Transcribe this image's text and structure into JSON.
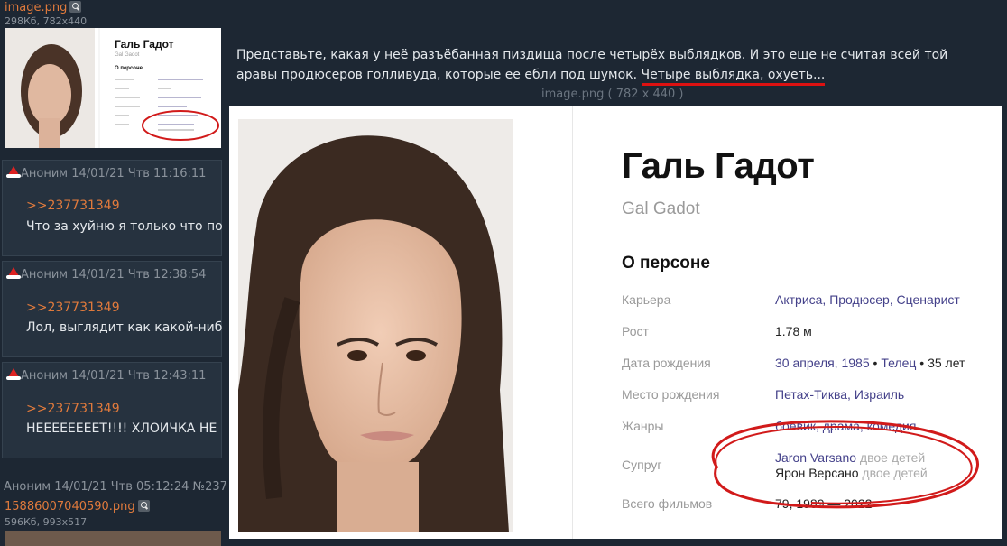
{
  "sidebar": {
    "file1": {
      "name": "image.png",
      "meta": "298Кб, 782x440"
    },
    "posts": [
      {
        "author": "Аноним",
        "date": "14/01/21 Чтв 11:16:11",
        "reply": ">>237731349",
        "text": "Что за хуйню я только что по"
      },
      {
        "author": "Аноним",
        "date": "14/01/21 Чтв 12:38:54",
        "reply": ">>237731349",
        "text": "Лол, выглядит как какой-ниб"
      },
      {
        "author": "Аноним",
        "date": "14/01/21 Чтв 12:43:11",
        "reply": ">>237731349",
        "text": "НЕЕЕЕЕЕЕЕТ!!!! ХЛОИЧКА НЕ"
      }
    ],
    "post4_head": "Аноним 14/01/21 Чтв 05:12:24 №237",
    "file2": {
      "name": "15886007040590.png",
      "meta": "596Кб, 993x517"
    }
  },
  "main": {
    "text_line1": "Представьте, какая у неё разъёбанная пиздища после четырёх выблядков. И это еще не считая всей той",
    "text_line2": "аравы продюсеров голливуда, которые ее ебли под шумок.",
    "text_underlined": "Четыре выблядка, охуеть...",
    "caption": "image.png ( 782 x 440 )"
  },
  "card": {
    "name": "Галь Гадот",
    "original_name": "Gal Gadot",
    "section_title": "О персоне",
    "rows": [
      {
        "label": "Карьера",
        "value": "Актриса, Продюсер, Сценарист"
      },
      {
        "label": "Рост",
        "value": "1.78 м"
      },
      {
        "label": "Дата рождения",
        "value_date": "30 апреля, 1985",
        "value_zodiac": "Телец",
        "value_age": "35 лет"
      },
      {
        "label": "Место рождения",
        "value": "Петах-Тиква, Израиль"
      },
      {
        "label": "Жанры",
        "value": "боевик, драма, комедия"
      },
      {
        "label": "Супруг",
        "spouse1": "Jaron Varsano",
        "spouse1_note": "двое детей",
        "spouse2": "Ярон Версано",
        "spouse2_note": "двое детей"
      },
      {
        "label": "Всего фильмов",
        "value": "79, 1989 — 2022"
      }
    ]
  },
  "thumb": {
    "name": "Галь Гадот",
    "original_name": "Gal Gadot",
    "section_title": "О персоне"
  },
  "colors": {
    "accent": "#e07a3c",
    "circle": "#d11a1a",
    "link": "#44418a",
    "bg": "#1d2733"
  }
}
